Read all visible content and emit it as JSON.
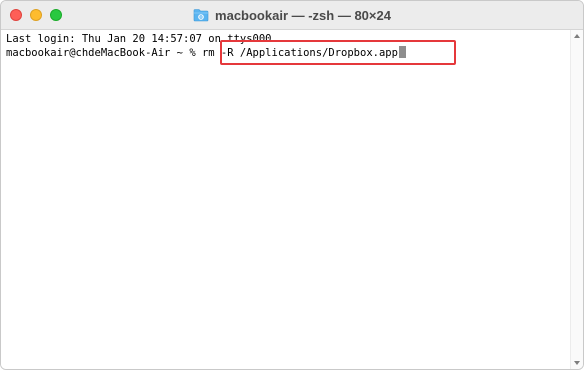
{
  "window": {
    "title": "macbookair — -zsh — 80×24",
    "title_icon": "folder-icon"
  },
  "terminal": {
    "last_login_line": "Last login: Thu Jan 20 14:57:07 on ttys000",
    "prompt": "macbookair@chdeMacBook-Air ~ % ",
    "command": "rm -R /Applications/Dropbox.app"
  },
  "colors": {
    "highlight_border": "#e5383b",
    "close_button": "#fe5f57",
    "minimize_button": "#febc2e",
    "maximize_button": "#28c840",
    "folder_icon": "#5ab4f0"
  }
}
